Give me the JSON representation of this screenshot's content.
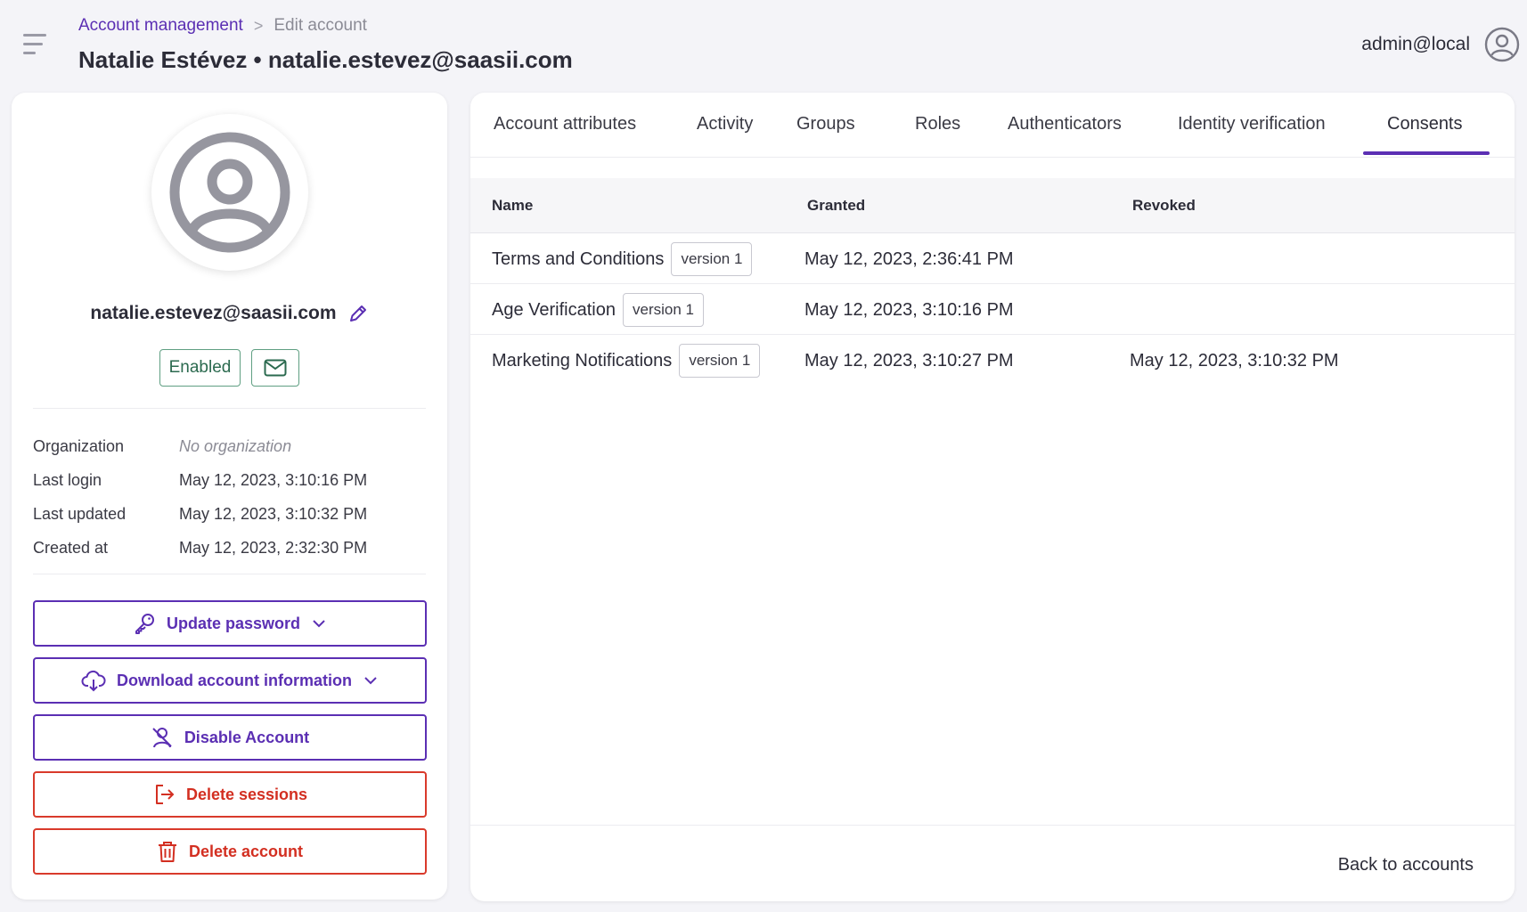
{
  "header": {
    "breadcrumb": {
      "link": "Account management",
      "separator": ">",
      "current": "Edit account"
    },
    "title": "Natalie Estévez • natalie.estevez@saasii.com",
    "user": "admin@local"
  },
  "profile": {
    "email": "natalie.estevez@saasii.com",
    "status": "Enabled",
    "info": [
      {
        "label": "Organization",
        "value": "No organization"
      },
      {
        "label": "Last login",
        "value": "May 12, 2023, 3:10:16 PM"
      },
      {
        "label": "Last updated",
        "value": "May 12, 2023, 3:10:32 PM"
      },
      {
        "label": "Created at",
        "value": "May 12, 2023, 2:32:30 PM"
      }
    ],
    "actions": {
      "update_password": "Update password",
      "download_info": "Download account information",
      "disable": "Disable Account",
      "delete_sessions": "Delete sessions",
      "delete_account": "Delete account"
    }
  },
  "tabs": [
    "Account attributes",
    "Activity",
    "Groups",
    "Roles",
    "Authenticators",
    "Identity verification",
    "Consents"
  ],
  "active_tab": "Consents",
  "consents": {
    "columns": [
      "Name",
      "Granted",
      "Revoked"
    ],
    "rows": [
      {
        "name": "Terms and Conditions",
        "version": "version 1",
        "granted": "May 12, 2023, 2:36:41 PM",
        "revoked": ""
      },
      {
        "name": "Age Verification",
        "version": "version 1",
        "granted": "May 12, 2023, 3:10:16 PM",
        "revoked": ""
      },
      {
        "name": "Marketing Notifications",
        "version": "version 1",
        "granted": "May 12, 2023, 3:10:27 PM",
        "revoked": "May 12, 2023, 3:10:32 PM"
      }
    ]
  },
  "footer": {
    "back": "Back to accounts"
  },
  "colors": {
    "accent": "#5b2fb3",
    "danger": "#d32f21",
    "success": "#2b6a4f"
  }
}
